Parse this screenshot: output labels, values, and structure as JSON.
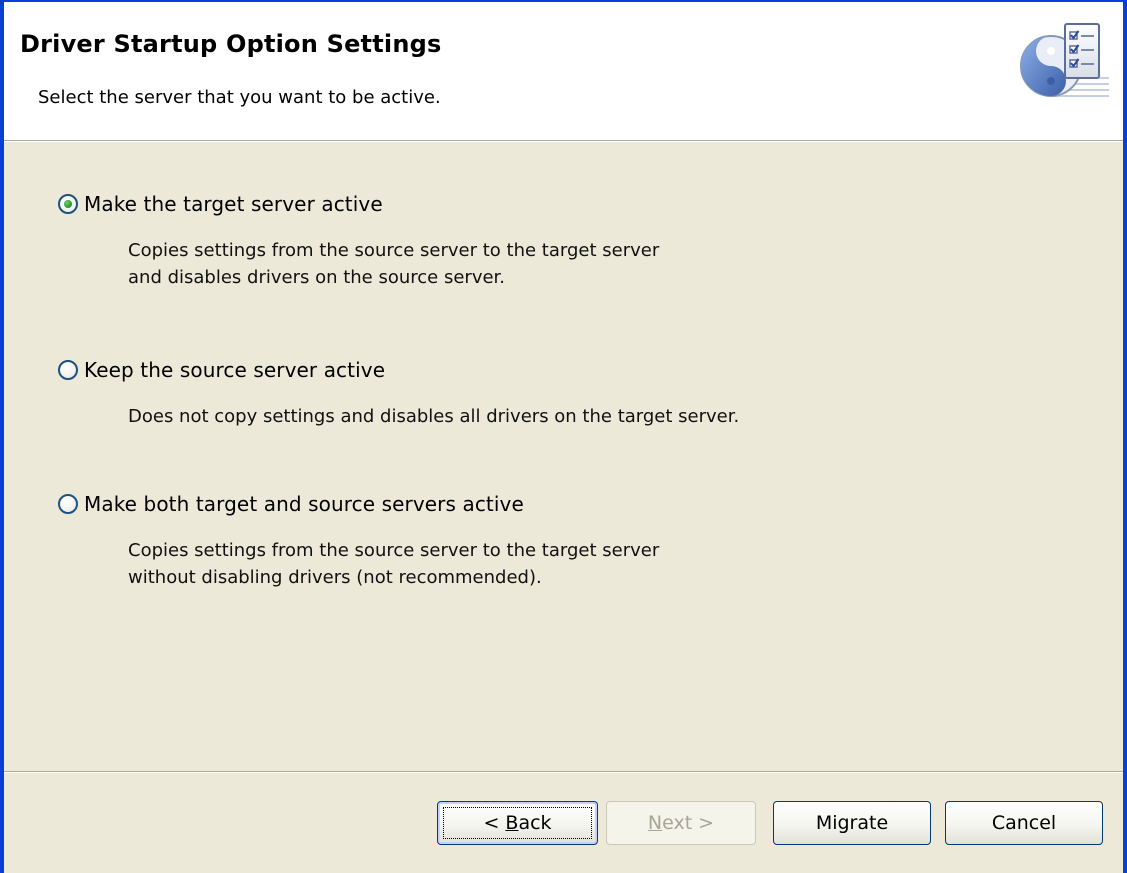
{
  "header": {
    "title": "Driver Startup Option Settings",
    "subtitle": "Select the server that you want to be active.",
    "icon": "checklist-yinyang-icon"
  },
  "options": [
    {
      "label": "Make the target server active",
      "description_lines": [
        "Copies settings from the source server to the target server",
        "and disables drivers on the source server."
      ],
      "selected": true
    },
    {
      "label": "Keep the source server active",
      "description_lines": [
        "Does not copy settings and disables all drivers on the target server."
      ],
      "selected": false
    },
    {
      "label": "Make both target and source servers active",
      "description_lines": [
        "Copies settings from the source server to the target server",
        "without disabling drivers (not recommended)."
      ],
      "selected": false
    }
  ],
  "buttons": {
    "back_prefix": "< ",
    "back_mnemonic": "B",
    "back_rest": "ack",
    "next_mnemonic": "N",
    "next_rest": "ext >",
    "migrate": "Migrate",
    "cancel": "Cancel"
  },
  "colors": {
    "frame": "#0a3fd6",
    "dialog_bg": "#ece9d8",
    "header_bg": "#ffffff",
    "radio_dot": "#2f9a2f",
    "button_border": "#003c74"
  }
}
